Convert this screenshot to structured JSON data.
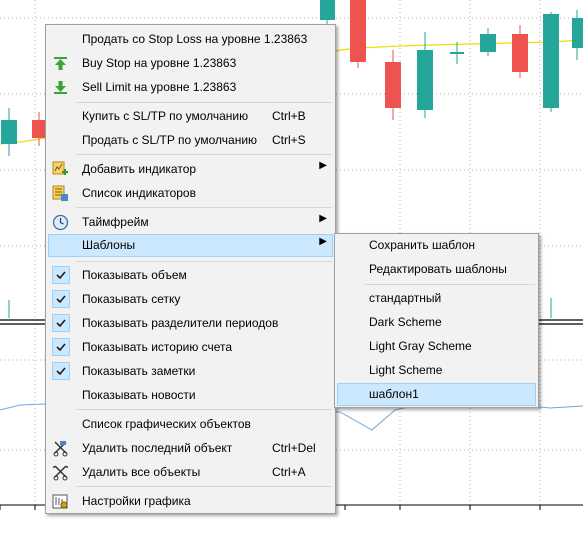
{
  "main_menu": {
    "items": [
      {
        "label": "Продать со Stop Loss на уровне 1.23863"
      },
      {
        "label": "Buy Stop на уровне 1.23863",
        "icon": "buy-stop-arrow-icon"
      },
      {
        "label": "Sell Limit на уровне 1.23863",
        "icon": "sell-limit-arrow-icon"
      },
      {
        "label": "Купить с SL/TP по умолчанию",
        "shortcut": "Ctrl+B"
      },
      {
        "label": "Продать с SL/TP по умолчанию",
        "shortcut": "Ctrl+S"
      },
      {
        "label": "Добавить индикатор",
        "icon": "add-indicator-icon",
        "submenu": "▶"
      },
      {
        "label": "Список индикаторов",
        "icon": "indicator-list-icon"
      },
      {
        "label": "Таймфрейм",
        "icon": "clock-icon",
        "submenu": "▶"
      },
      {
        "label": "Шаблоны",
        "submenu": "▶",
        "highlighted": true
      },
      {
        "label": "Показывать объем",
        "checked": true
      },
      {
        "label": "Показывать сетку",
        "checked": true
      },
      {
        "label": "Показывать разделители периодов",
        "checked": true
      },
      {
        "label": "Показывать историю счета",
        "checked": true
      },
      {
        "label": "Показывать заметки",
        "checked": true
      },
      {
        "label": "Показывать новости",
        "checked": false
      },
      {
        "label": "Список графических объектов"
      },
      {
        "label": "Удалить последний объект",
        "shortcut": "Ctrl+Del",
        "icon": "delete-last-object-icon"
      },
      {
        "label": "Удалить все объекты",
        "shortcut": "Ctrl+A",
        "icon": "delete-all-objects-icon"
      },
      {
        "label": "Настройки графика",
        "icon": "chart-settings-icon"
      }
    ]
  },
  "templates_submenu": {
    "items": [
      {
        "label": "Сохранить шаблон"
      },
      {
        "label": "Редактировать шаблоны"
      },
      {
        "label": "стандартный"
      },
      {
        "label": "Dark Scheme"
      },
      {
        "label": "Light Gray Scheme"
      },
      {
        "label": "Light Scheme"
      },
      {
        "label": "шаблон1",
        "highlighted": true
      }
    ]
  },
  "colors": {
    "bull_candle": "#26a69a",
    "bear_candle": "#ef5350",
    "moving_average": "#f5d90a",
    "oscillator": "#6fa8dc",
    "menu_background": "#f2f2f2",
    "highlight": "#cce8ff",
    "highlight_border": "#99d1ff"
  }
}
